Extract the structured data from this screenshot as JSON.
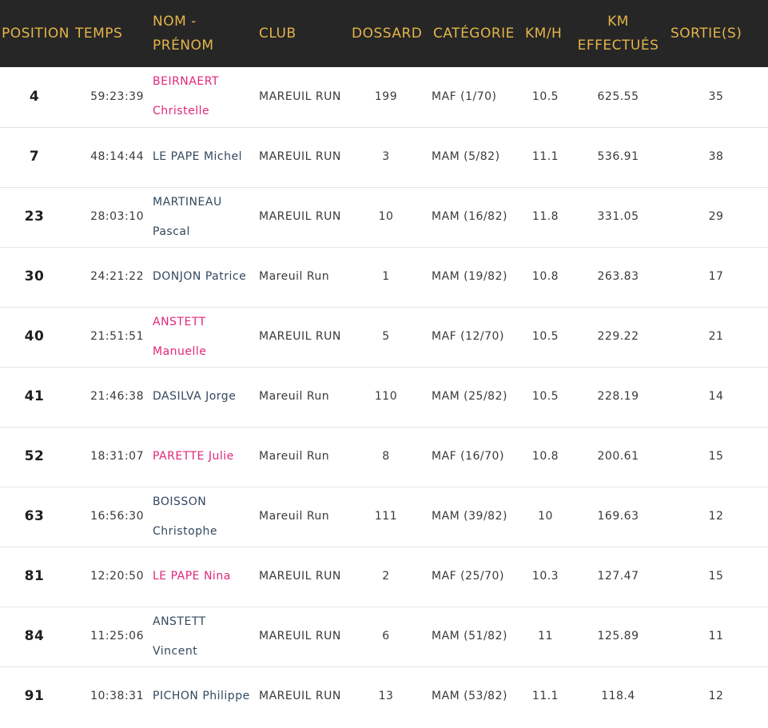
{
  "headers": {
    "position": "POSITION",
    "temps": "TEMPS",
    "nom": "NOM - PRÉNOM",
    "club": "CLUB",
    "dossard": "DOSSARD",
    "categorie": "CATÉGORIE",
    "kmh": "KM/H",
    "km": "KM EFFECTUÉS",
    "sorties": "SORTIE(S)"
  },
  "colors": {
    "header_bg": "#262626",
    "header_text": "#e3b44a",
    "female_name": "#e0287a",
    "male_name": "#33495e"
  },
  "rows": [
    {
      "position": "4",
      "temps": "59:23:39",
      "nom": "BEIRNAERT Christelle",
      "gender": "female",
      "club": "MAREUIL RUN",
      "dossard": "199",
      "categorie": "MAF (1/70)",
      "kmh": "10.5",
      "km": "625.55",
      "sorties": "35"
    },
    {
      "position": "7",
      "temps": "48:14:44",
      "nom": "LE PAPE Michel",
      "gender": "male",
      "club": "MAREUIL RUN",
      "dossard": "3",
      "categorie": "MAM (5/82)",
      "kmh": "11.1",
      "km": "536.91",
      "sorties": "38"
    },
    {
      "position": "23",
      "temps": "28:03:10",
      "nom": "MARTINEAU Pascal",
      "gender": "male",
      "club": "MAREUIL RUN",
      "dossard": "10",
      "categorie": "MAM (16/82)",
      "kmh": "11.8",
      "km": "331.05",
      "sorties": "29"
    },
    {
      "position": "30",
      "temps": "24:21:22",
      "nom": "DONJON Patrice",
      "gender": "male",
      "club": "Mareuil Run",
      "dossard": "1",
      "categorie": "MAM (19/82)",
      "kmh": "10.8",
      "km": "263.83",
      "sorties": "17"
    },
    {
      "position": "40",
      "temps": "21:51:51",
      "nom": "ANSTETT Manuelle",
      "gender": "female",
      "club": "MAREUIL RUN",
      "dossard": "5",
      "categorie": "MAF (12/70)",
      "kmh": "10.5",
      "km": "229.22",
      "sorties": "21"
    },
    {
      "position": "41",
      "temps": "21:46:38",
      "nom": "DASILVA Jorge",
      "gender": "male",
      "club": "Mareuil Run",
      "dossard": "110",
      "categorie": "MAM (25/82)",
      "kmh": "10.5",
      "km": "228.19",
      "sorties": "14"
    },
    {
      "position": "52",
      "temps": "18:31:07",
      "nom": "PARETTE Julie",
      "gender": "female",
      "club": "Mareuil Run",
      "dossard": "8",
      "categorie": "MAF (16/70)",
      "kmh": "10.8",
      "km": "200.61",
      "sorties": "15"
    },
    {
      "position": "63",
      "temps": "16:56:30",
      "nom": "BOISSON Christophe",
      "gender": "male",
      "club": "Mareuil Run",
      "dossard": "111",
      "categorie": "MAM (39/82)",
      "kmh": "10",
      "km": "169.63",
      "sorties": "12"
    },
    {
      "position": "81",
      "temps": "12:20:50",
      "nom": "LE PAPE Nina",
      "gender": "female",
      "club": "MAREUIL RUN",
      "dossard": "2",
      "categorie": "MAF (25/70)",
      "kmh": "10.3",
      "km": "127.47",
      "sorties": "15"
    },
    {
      "position": "84",
      "temps": "11:25:06",
      "nom": "ANSTETT Vincent",
      "gender": "male",
      "club": "MAREUIL RUN",
      "dossard": "6",
      "categorie": "MAM (51/82)",
      "kmh": "11",
      "km": "125.89",
      "sorties": "11"
    },
    {
      "position": "91",
      "temps": "10:38:31",
      "nom": "PICHON Philippe",
      "gender": "male",
      "club": "MAREUIL RUN",
      "dossard": "13",
      "categorie": "MAM (53/82)",
      "kmh": "11.1",
      "km": "118.4",
      "sorties": "12"
    }
  ]
}
